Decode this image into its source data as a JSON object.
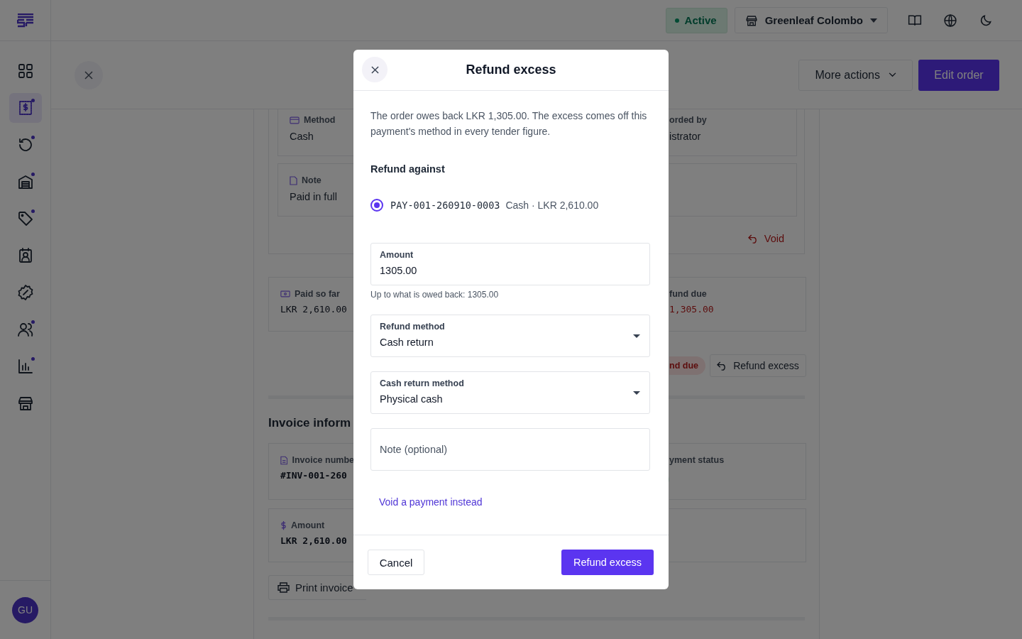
{
  "sidebar": {
    "items": [
      {
        "kind": "grid",
        "selected": false,
        "dot": false
      },
      {
        "kind": "receipt",
        "selected": true,
        "dot": true
      },
      {
        "kind": "refresh",
        "selected": false,
        "dot": true
      },
      {
        "kind": "warehouse",
        "selected": false,
        "dot": true
      },
      {
        "kind": "tag",
        "selected": false,
        "dot": true
      },
      {
        "kind": "contact",
        "selected": false,
        "dot": false
      },
      {
        "kind": "discount",
        "selected": false,
        "dot": false
      },
      {
        "kind": "users",
        "selected": false,
        "dot": true
      },
      {
        "kind": "chart",
        "selected": false,
        "dot": true
      },
      {
        "kind": "store",
        "selected": false,
        "dot": false
      }
    ],
    "avatar": "GU"
  },
  "topbar": {
    "status": "Active",
    "store": "Greenleaf Colombo"
  },
  "page_header": {
    "more_actions": "More actions",
    "edit": "Edit order"
  },
  "payment_card": {
    "left": [
      {
        "kind": "card",
        "label": "Method",
        "value": "Cash"
      },
      {
        "kind": "note",
        "label": "Note",
        "value": "Paid in full"
      }
    ],
    "right": [
      {
        "label": "orded by",
        "value": "istrator"
      }
    ],
    "void": "Void"
  },
  "summary": {
    "left": {
      "label": "Paid so far",
      "value": "LKR 2,610.00"
    },
    "right": {
      "label": "fund due",
      "value": "1,305.00"
    }
  },
  "actions": {
    "badge": "nd due",
    "button": "Refund excess"
  },
  "invoice": {
    "heading": "Invoice inform",
    "left": [
      {
        "kind": "doc",
        "label": "Invoice numbe",
        "value": "#INV-001-260"
      },
      {
        "kind": "dollar",
        "label": "Amount",
        "value": "LKR 2,610.00"
      }
    ],
    "right": [
      {
        "label": "yment status"
      }
    ],
    "print": "Print invoice"
  },
  "dialog": {
    "title": "Refund excess",
    "description": "The order owes back LKR 1,305.00. The excess comes off this payment's method in every tender figure.",
    "section": "Refund against",
    "payments": [
      {
        "reference": "PAY-001-260910-0003",
        "detail": "Cash · LKR 2,610.00",
        "selected": true
      }
    ],
    "amount": {
      "label": "Amount",
      "value": "1305.00",
      "hint": "Up to what is owed back: 1305.00"
    },
    "refund_method": {
      "label": "Refund method",
      "value": "Cash return"
    },
    "cash_method": {
      "label": "Cash return method",
      "value": "Physical cash"
    },
    "note": {
      "placeholder": "Note (optional)"
    },
    "link": "Void a payment instead",
    "cancel": "Cancel",
    "submit": "Refund excess"
  }
}
